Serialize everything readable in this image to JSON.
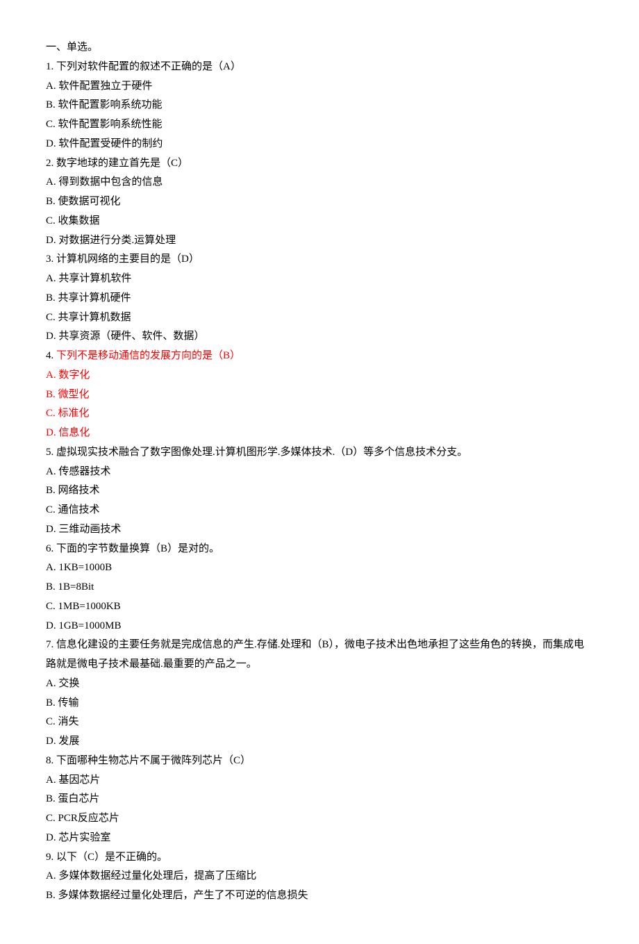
{
  "header": "一、单选。",
  "items": [
    {
      "num": "1",
      "stem": "下列对软件配置的叙述不正确的是（A）",
      "highlight": false,
      "opts": [
        {
          "label": "A",
          "text": "软件配置独立于硬件"
        },
        {
          "label": "B",
          "text": "软件配置影响系统功能"
        },
        {
          "label": "C",
          "text": "软件配置影响系统性能"
        },
        {
          "label": "D",
          "text": "软件配置受硬件的制约"
        }
      ]
    },
    {
      "num": "2",
      "stem": "数字地球的建立首先是（C）",
      "highlight": false,
      "opts": [
        {
          "label": "A",
          "text": "得到数据中包含的信息"
        },
        {
          "label": "B",
          "text": "使数据可视化"
        },
        {
          "label": "C",
          "text": "收集数据"
        },
        {
          "label": "D",
          "text": "对数据进行分类.运算处理"
        }
      ]
    },
    {
      "num": "3",
      "stem": "计算机网络的主要目的是（D）",
      "highlight": false,
      "opts": [
        {
          "label": "A",
          "text": "共享计算机软件"
        },
        {
          "label": "B",
          "text": "共享计算机硬件"
        },
        {
          "label": "C",
          "text": "共享计算机数据"
        },
        {
          "label": "D",
          "text": "共享资源（硬件、软件、数据）"
        }
      ]
    },
    {
      "num": "4",
      "stem": "下列不是移动通信的发展方向的是（B）",
      "highlight": true,
      "opts": [
        {
          "label": "A",
          "text": "数字化"
        },
        {
          "label": "B",
          "text": "微型化"
        },
        {
          "label": "C",
          "text": "标准化"
        },
        {
          "label": "D",
          "text": "信息化"
        }
      ]
    },
    {
      "num": "5",
      "stem": "虚拟现实技术融合了数字图像处理.计算机图形学.多媒体技术.（D）等多个信息技术分支。",
      "highlight": false,
      "opts": [
        {
          "label": "A",
          "text": "传感器技术"
        },
        {
          "label": "B",
          "text": "网络技术"
        },
        {
          "label": "C",
          "text": "通信技术"
        },
        {
          "label": "D",
          "text": "三维动画技术"
        }
      ]
    },
    {
      "num": "6",
      "stem": "下面的字节数量换算（B）是对的。",
      "highlight": false,
      "opts": [
        {
          "label": "A",
          "text": "1KB=1000B"
        },
        {
          "label": "B",
          "text": "1B=8Bit"
        },
        {
          "label": "C",
          "text": "1MB=1000KB"
        },
        {
          "label": "D",
          "text": "1GB=1000MB"
        }
      ]
    },
    {
      "num": "7",
      "stem": "信息化建设的主要任务就是完成信息的产生.存储.处理和（B），微电子技术出色地承担了这些角色的转换，而集成电路就是微电子技术最基础.最重要的产品之一。",
      "highlight": false,
      "opts": [
        {
          "label": "A",
          "text": "交换"
        },
        {
          "label": "B",
          "text": "传输"
        },
        {
          "label": "C",
          "text": "消失"
        },
        {
          "label": "D",
          "text": "发展"
        }
      ]
    },
    {
      "num": "8",
      "stem": "下面哪种生物芯片不属于微阵列芯片（C）",
      "highlight": false,
      "opts": [
        {
          "label": "A",
          "text": "基因芯片"
        },
        {
          "label": "B",
          "text": "蛋白芯片"
        },
        {
          "label": "C",
          "text": "PCR反应芯片"
        },
        {
          "label": "D",
          "text": "芯片实验室"
        }
      ]
    },
    {
      "num": "9",
      "stem": "以下（C）是不正确的。",
      "highlight": false,
      "opts": [
        {
          "label": "A",
          "text": "多媒体数据经过量化处理后，提高了压缩比"
        },
        {
          "label": "B",
          "text": "多媒体数据经过量化处理后，产生了不可逆的信息损失"
        }
      ]
    }
  ]
}
